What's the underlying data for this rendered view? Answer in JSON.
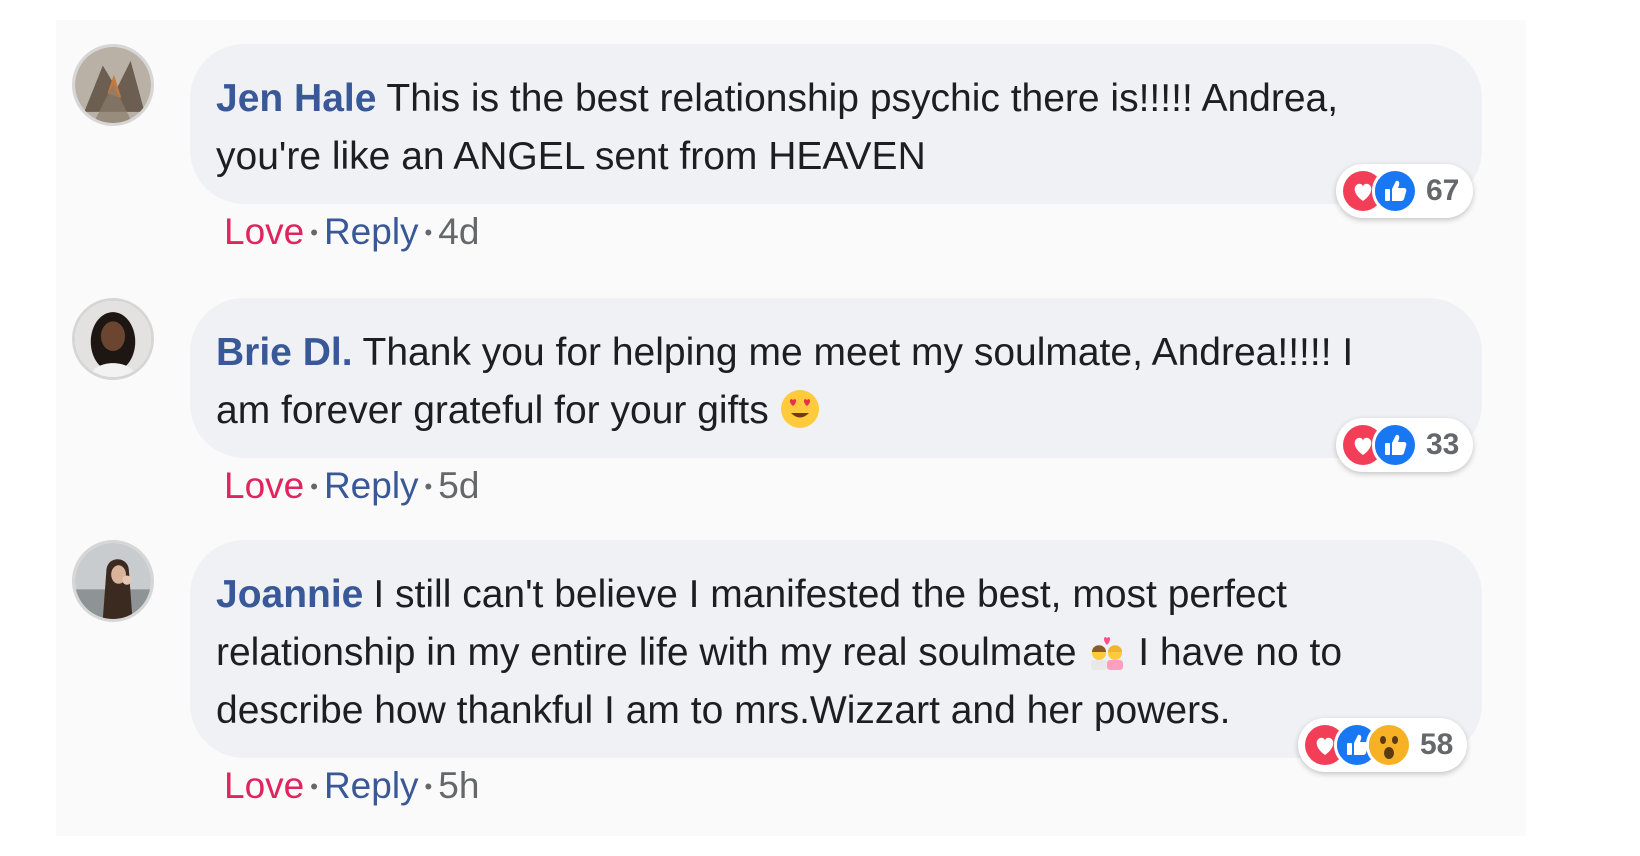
{
  "comments": [
    {
      "author": "Jen Hale",
      "text": "This is the best relationship psychic there is!!!!! Andrea, you're like an ANGEL sent from HEAVEN",
      "reaction_count": "67",
      "action_love": "Love",
      "action_reply": "Reply",
      "timestamp": "4d"
    },
    {
      "author": "Brie Dl.",
      "text": "Thank you for helping me meet my soulmate, Andrea!!!!! I am forever grateful for your gifts",
      "reaction_count": "33",
      "action_love": "Love",
      "action_reply": "Reply",
      "timestamp": "5d"
    },
    {
      "author": "Joannie",
      "text_part1": "I still can't believe I manifested the best, most perfect relationship in my entire life with my real soulmate",
      "text_part2": "I have no to describe how thankful I am to mrs.Wizzart and her powers.",
      "reaction_count": "58",
      "action_love": "Love",
      "action_reply": "Reply",
      "timestamp": "5h"
    }
  ],
  "icons": {
    "love_reaction": "heart-reaction-icon",
    "like_reaction": "like-reaction-icon",
    "wow_reaction": "wow-reaction-icon",
    "heart_eyes_emoji": "heart-eyes-emoji-icon",
    "couple_emoji": "couple-with-heart-emoji-icon"
  },
  "colors": {
    "author": "#385898",
    "love_action": "#e0245e",
    "reply_action": "#385898",
    "timestamp": "#65676b",
    "bubble_bg": "#eff1f4",
    "love_reaction": "#f33e58",
    "like_reaction": "#1877f2"
  }
}
